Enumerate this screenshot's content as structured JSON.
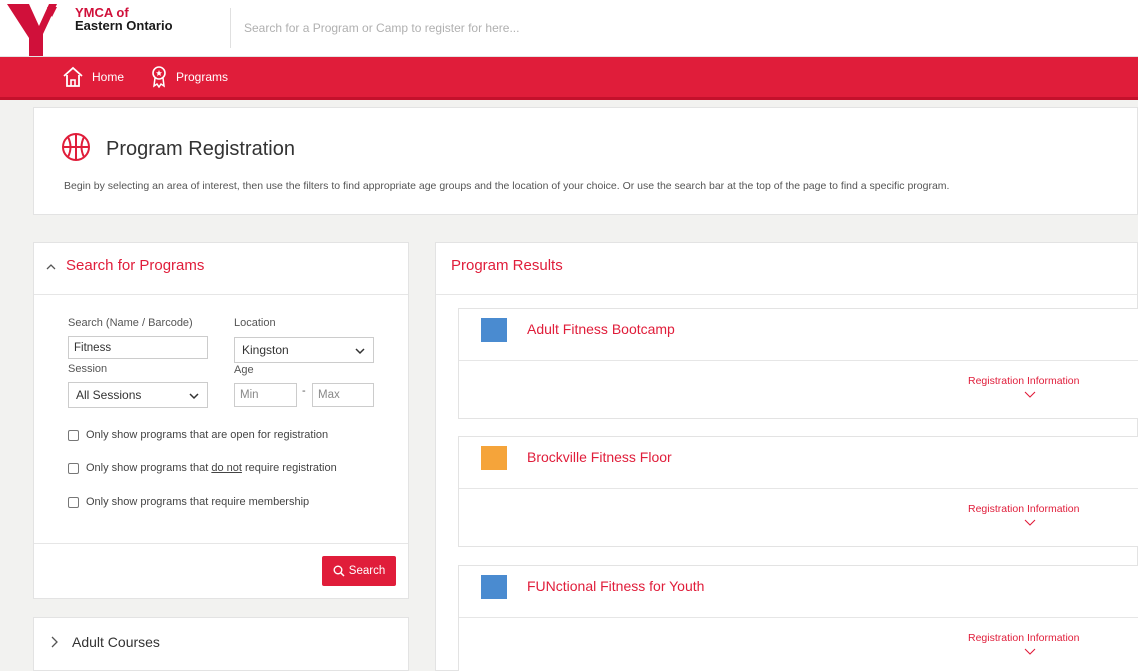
{
  "header": {
    "logo_line1": "YMCA of",
    "logo_line2": "Eastern Ontario",
    "search_placeholder": "Search for a Program or Camp to register for here..."
  },
  "nav": {
    "home": "Home",
    "programs": "Programs"
  },
  "hero": {
    "title": "Program Registration",
    "description": "Begin by selecting an area of interest, then use the filters to find appropriate age groups and the location of your choice. Or use the search bar at the top of the page to find a specific program."
  },
  "search_panel": {
    "title": "Search for Programs",
    "search_label": "Search (Name / Barcode)",
    "search_value": "Fitness",
    "location_label": "Location",
    "location_value": "Kingston",
    "session_label": "Session",
    "session_value": "All Sessions",
    "age_label": "Age",
    "age_min_placeholder": "Min",
    "age_max_placeholder": "Max",
    "age_separator": "-",
    "check_open": "Only show programs that are open for registration",
    "check_no_reg_before": "Only show programs that ",
    "check_no_reg_underline": "do not",
    "check_no_reg_after": " require registration",
    "check_membership": "Only show programs that require membership",
    "search_button": "Search"
  },
  "adult_courses": {
    "title": "Adult Courses"
  },
  "results": {
    "title": "Program Results",
    "programs": [
      {
        "name": "Adult Fitness Bootcamp",
        "color": "#4a8bd0",
        "link": "Registration Information"
      },
      {
        "name": "Brockville Fitness Floor",
        "color": "#f5a43a",
        "link": "Registration Information"
      },
      {
        "name": "FUNctional Fitness for Youth",
        "color": "#4a8bd0",
        "link": "Registration Information"
      }
    ]
  },
  "colors": {
    "brand_red": "#e01d3a"
  }
}
